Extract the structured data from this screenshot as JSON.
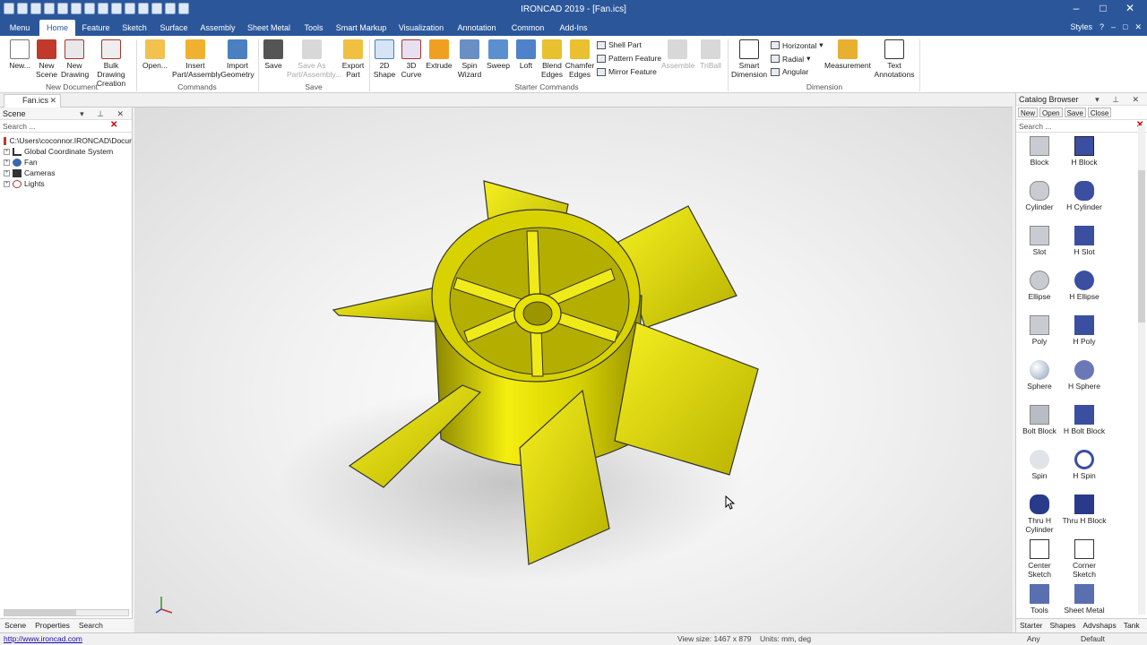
{
  "window": {
    "title": "IRONCAD 2019 - [Fan.ics]"
  },
  "menu": {
    "tabs": [
      "Menu",
      "Home",
      "Feature",
      "Sketch",
      "Surface",
      "Assembly",
      "Sheet Metal",
      "Tools",
      "Smart Markup",
      "Visualization",
      "Annotation",
      "Common",
      "Add-Ins"
    ],
    "active": "Home",
    "styles_label": "Styles"
  },
  "ribbon": {
    "buttons": [
      {
        "label": "New...",
        "enabled": true
      },
      {
        "label": "New Scene",
        "enabled": true
      },
      {
        "label": "New Drawing",
        "enabled": true
      },
      {
        "label": "Bulk Drawing Creation",
        "enabled": true
      },
      {
        "label": "Open...",
        "enabled": true
      },
      {
        "label": "Insert Part/Assembly",
        "enabled": true
      },
      {
        "label": "Import Geometry",
        "enabled": true
      },
      {
        "label": "Save",
        "enabled": true
      },
      {
        "label": "Save As Part/Assembly...",
        "enabled": false
      },
      {
        "label": "Export Part",
        "enabled": true
      },
      {
        "label": "2D Shape",
        "enabled": true
      },
      {
        "label": "3D Curve",
        "enabled": true
      },
      {
        "label": "Extrude",
        "enabled": true
      },
      {
        "label": "Spin Wizard",
        "enabled": true
      },
      {
        "label": "Sweep",
        "enabled": true
      },
      {
        "label": "Loft",
        "enabled": true
      },
      {
        "label": "Blend Edges",
        "enabled": true
      },
      {
        "label": "Chamfer Edges",
        "enabled": true
      },
      {
        "label": "Assemble",
        "enabled": false
      },
      {
        "label": "TriBall",
        "enabled": false
      },
      {
        "label": "Smart Dimension",
        "enabled": true
      },
      {
        "label": "Measurement",
        "enabled": true
      },
      {
        "label": "Text Annotations",
        "enabled": true
      }
    ],
    "small": {
      "shell": "Shell Part",
      "pattern": "Pattern Feature",
      "mirror": "Mirror Feature",
      "horizontal": "Horizontal",
      "radial": "Radial",
      "angular": "Angular"
    },
    "groups": [
      "New Document",
      "Commands",
      "Save",
      "Starter Commands",
      "Dimension"
    ]
  },
  "document_tab": "Fan.ics",
  "scene_panel": {
    "title": "Scene",
    "search_placeholder": "Search ...",
    "tree": [
      {
        "label": "C:\\Users\\coconnor.IRONCAD\\Docur"
      },
      {
        "label": "Global Coordinate System"
      },
      {
        "label": "Fan"
      },
      {
        "label": "Cameras"
      },
      {
        "label": "Lights"
      }
    ],
    "tabs": [
      "Scene",
      "Properties",
      "Search"
    ]
  },
  "catalog": {
    "title": "Catalog Browser",
    "toolbar": [
      "New",
      "Open",
      "Save",
      "Close"
    ],
    "search_placeholder": "Search ...",
    "items": [
      "Block",
      "H Block",
      "Cylinder",
      "H Cylinder",
      "Slot",
      "H Slot",
      "Ellipse",
      "H Ellipse",
      "Poly",
      "H Poly",
      "Sphere",
      "H Sphere",
      "Bolt Block",
      "H Bolt Block",
      "Spin",
      "H Spin",
      "Thru H Cylinder",
      "Thru H Block",
      "Center Sketch",
      "Corner Sketch",
      "Tools",
      "Sheet Metal"
    ],
    "tabs": [
      "Starter",
      "Shapes",
      "Advshaps",
      "Tank"
    ]
  },
  "status": {
    "link": "http://www.ironcad.com",
    "view_size": "View size: 1467 x 879",
    "units": "Units: mm, deg",
    "filter": "Any",
    "style": "Default"
  },
  "colors": {
    "accent": "#2b579a",
    "model": "#e8e200"
  }
}
